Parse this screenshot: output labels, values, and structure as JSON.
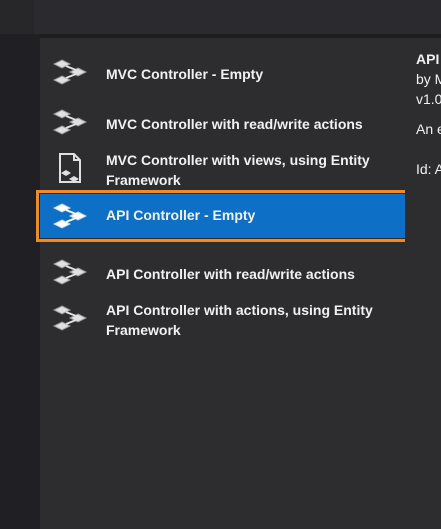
{
  "templates": [
    {
      "label": "MVC Controller - Empty",
      "icon": "controller-icon"
    },
    {
      "label": "MVC Controller with read/write actions",
      "icon": "controller-icon"
    },
    {
      "label": "MVC Controller with views, using Entity Framework",
      "icon": "file-controller-icon"
    },
    {
      "label": "API Controller - Empty",
      "icon": "controller-icon"
    },
    {
      "label": "API Controller with read/write actions",
      "icon": "controller-icon"
    },
    {
      "label": "API Controller with actions, using Entity Framework",
      "icon": "controller-icon"
    }
  ],
  "selected_index": 3,
  "details": {
    "name": "API",
    "by": "by M",
    "version": "v1.0",
    "description": "An e",
    "id": "Id: A"
  },
  "colors": {
    "selection_background": "#0e6fc6",
    "selection_outline": "#f08a24",
    "panel_background": "#2d2d30"
  }
}
